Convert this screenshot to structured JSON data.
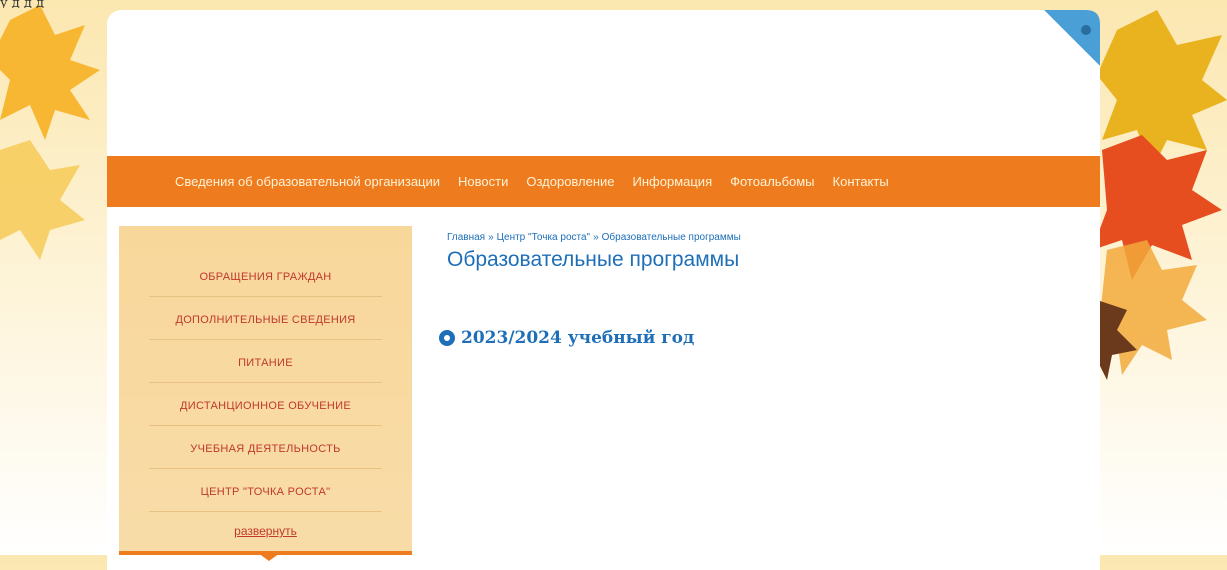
{
  "top_strip_text": "у                            д              д д",
  "nav": {
    "items": [
      "Сведения об образовательной организации",
      "Новости",
      "Оздоровление",
      "Информация",
      "Фотоальбомы",
      "Контакты"
    ]
  },
  "sidebar": {
    "items": [
      "ОБРАЩЕНИЯ ГРАЖДАН",
      "ДОПОЛНИТЕЛЬНЫЕ СВЕДЕНИЯ",
      "ПИТАНИЕ",
      "ДИСТАНЦИОННОЕ ОБУЧЕНИЕ",
      "УЧЕБНАЯ ДЕЯТЕЛЬНОСТЬ",
      "ЦЕНТР \"ТОЧКА РОСТА\""
    ],
    "expand_label": "развернуть"
  },
  "breadcrumb": {
    "home": "Главная",
    "section": "Центр \"Точка роста\"",
    "current": "Образовательные программы",
    "separator": "»"
  },
  "page_title": "Образовательные программы",
  "content": {
    "year_link": "2023/2024 учебный год"
  },
  "colors": {
    "nav_bg": "#ef7b1f",
    "sidebar_bg": "#f8d79a",
    "link_blue": "#1e6fb8",
    "sidebar_link": "#c0392b"
  }
}
